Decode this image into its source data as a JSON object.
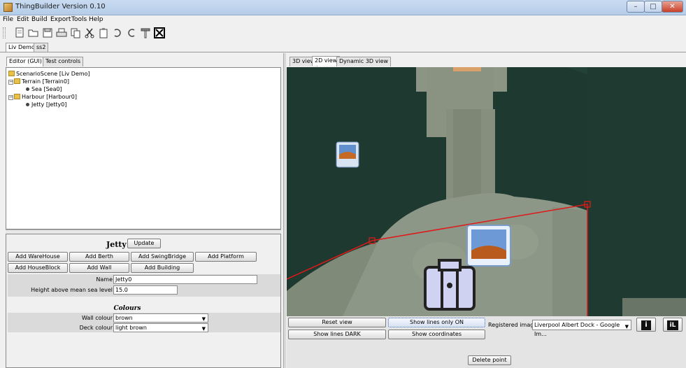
{
  "window": {
    "title": "ThingBuilder Version 0.10",
    "controls": {
      "minimize": "–",
      "maximize": "□",
      "close": "✕"
    }
  },
  "menu": [
    "File",
    "Edit",
    "Build",
    "Export",
    "Tools",
    "Help"
  ],
  "toolbar": {
    "icons": [
      "new-icon",
      "open-icon",
      "save-icon",
      "print-icon",
      "copy-icon",
      "cut-icon",
      "paste-icon",
      "undo-icon",
      "redo-icon",
      "hammer-icon",
      "close-box-icon"
    ]
  },
  "doc_tabs": [
    {
      "label": "Liv Demo",
      "active": true
    },
    {
      "label": "ss2",
      "active": false
    }
  ],
  "left_tabs": [
    {
      "label": "Editor (GUI)",
      "active": true
    },
    {
      "label": "Test controls",
      "active": false
    }
  ],
  "tree": [
    {
      "label": "ScenarioScene [Liv Demo]",
      "type": "folder"
    },
    {
      "label": "Terrain [Terrain0]",
      "type": "folder"
    },
    {
      "label": "Sea [Sea0]",
      "type": "leaf"
    },
    {
      "label": "Harbour [Harbour0]",
      "type": "folder"
    },
    {
      "label": "Jetty [Jetty0]",
      "type": "leaf"
    }
  ],
  "props": {
    "heading": "Jetty",
    "update_label": "Update",
    "buttons_row1": [
      "Add WareHouse",
      "Add Berth",
      "Add SwingBridge",
      "Add Platform"
    ],
    "buttons_row2": [
      "Add HouseBlock",
      "Add Wall",
      "Add Building"
    ],
    "name_label": "Name",
    "name_value": "Jetty0",
    "height_label": "Height above mean sea level",
    "height_value": "15.0",
    "colours_heading": "Colours",
    "wall_colour_label": "Wall colour",
    "wall_colour_value": "brown",
    "deck_colour_label": "Deck colour",
    "deck_colour_value": "light brown"
  },
  "view_tabs": [
    {
      "label": "3D view",
      "active": false
    },
    {
      "label": "2D view",
      "active": true
    },
    {
      "label": "Dynamic 3D view",
      "active": false
    }
  ],
  "map_controls": {
    "reset_view": "Reset view",
    "show_lines_only": "Show lines only  ON",
    "registered_image_label": "Registered image",
    "registered_image_value": "Liverpool Albert Dock - Google Im...",
    "show_lines_dark": "Show lines  DARK",
    "show_coordinates": "Show coordinates",
    "delete_point": "Delete point",
    "info_icon_label": "i",
    "il_icon_label": "iL"
  },
  "colors": {
    "line": "#e01818",
    "water": "#1e3a30",
    "land": "#8a9480"
  }
}
